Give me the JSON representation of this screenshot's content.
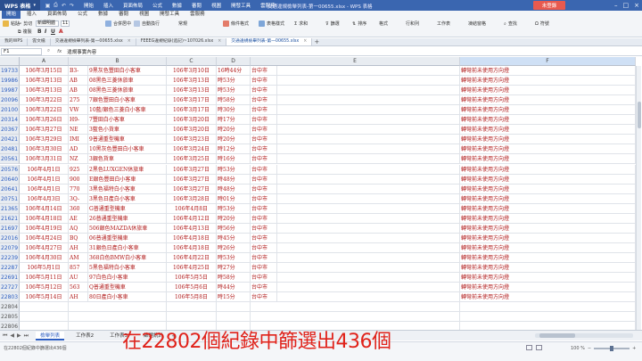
{
  "app": {
    "badge": "WPS 表格",
    "menus": [
      "開始",
      "插入",
      "頁面佈局",
      "公式",
      "數據",
      "審閱",
      "視圖",
      "開發工具",
      "雲服務"
    ],
    "doc_title": "交通違規檢舉列表-第一00655.xlsx - WPS 表格",
    "login_label": "未登錄",
    "accent": "#3a66b0"
  },
  "ribbon": {
    "active_tab": "開始",
    "font_name": "新細明體",
    "font_size": "11",
    "tools": [
      "剪切",
      "複製",
      "格式刷",
      "粘貼",
      "合併居中",
      "自動換行",
      "常規",
      "條件格式",
      "表格樣式",
      "求和",
      "篩選",
      "排序",
      "格式",
      "行和列",
      "工作表",
      "凍結窗格",
      "查找",
      "符號"
    ]
  },
  "doc_tabs": [
    {
      "label": "我的WPS",
      "active": false
    },
    {
      "label": "雲文檔",
      "active": false
    },
    {
      "label": "交通違規檢舉列表-第一00655.xlsx",
      "active": false
    },
    {
      "label": "FEEEG違規紀錄(追記)~107026.xlsx",
      "active": false
    },
    {
      "label": "交通違規檢舉列表-第一00655.xlsx",
      "active": true
    }
  ],
  "formula_bar": {
    "name_box": "F1",
    "content": "違規事實內容"
  },
  "columns": [
    "A",
    "B",
    "C",
    "D",
    "E",
    "F"
  ],
  "rows": [
    {
      "num": "19733",
      "a": "106年3月15日",
      "b": "B3-",
      "b2": "9黑灰色豐田白小客車",
      "c": "106年3月10日",
      "d": "16時44分",
      "d2": "台中市",
      "f": "轉彎前未使用方向燈"
    },
    {
      "num": "19986",
      "a": "106年3月13日",
      "b": "AB",
      "b2": "08黑色三菱休旅車",
      "c": "106年3月13日",
      "d": "時53分",
      "d2": "台中市",
      "f": "轉彎前未使用方向燈"
    },
    {
      "num": "19987",
      "a": "106年3月13日",
      "b": "AB",
      "b2": "08黑色三菱休旅車",
      "c": "106年3月13日",
      "d": "時53分",
      "d2": "台中市",
      "f": "轉彎前未使用方向燈"
    },
    {
      "num": "20096",
      "a": "106年3月22日",
      "b": "275",
      "b2": "7銀色豐田白小客車",
      "c": "106年3月17日",
      "d": "時58分",
      "d2": "台中市",
      "f": "轉彎前未使用方向燈"
    },
    {
      "num": "20100",
      "a": "106年3月22日",
      "b": "VW",
      "b2": "10藍/銀色三菱白小客車",
      "c": "106年3月17日",
      "d": "時30分",
      "d2": "台中市",
      "f": "轉彎前未使用方向燈"
    },
    {
      "num": "20314",
      "a": "106年3月26日",
      "b": "H9-",
      "b2": "7豐田白小客車",
      "c": "106年3月20日",
      "d": "時17分",
      "d2": "台中市",
      "f": "轉彎前未使用方向燈"
    },
    {
      "num": "20367",
      "a": "106年3月27日",
      "b": "NE",
      "b2": "3藍色小貨車",
      "c": "106年3月20日",
      "d": "時20分",
      "d2": "台中市",
      "f": "轉彎前未使用方向燈"
    },
    {
      "num": "20421",
      "a": "106年3月29日",
      "b": "IMI",
      "b2": "9普通重型機車",
      "c": "106年3月23日",
      "d": "時20分",
      "d2": "台中市",
      "f": "轉彎前未使用方向燈"
    },
    {
      "num": "20481",
      "a": "106年3月30日",
      "b": "AD",
      "b2": "10黑灰色豐田白小客車",
      "c": "106年3月24日",
      "d": "時12分",
      "d2": "台中市",
      "f": "轉彎前未使用方向燈"
    },
    {
      "num": "20561",
      "a": "106年3月31日",
      "b": "NZ",
      "b2": "3銀色貨車",
      "c": "106年3月25日",
      "d": "時16分",
      "d2": "台中市",
      "f": "轉彎前未使用方向燈"
    },
    {
      "num": "20576",
      "a": "106年4月1日",
      "b": "925",
      "b2": "2黑色LUXGEN休旅車",
      "c": "106年3月27日",
      "d": "時53分",
      "d2": "台中市",
      "f": "轉彎前未使用方向燈"
    },
    {
      "num": "20640",
      "a": "106年4月1日",
      "b": "900",
      "b2": "E銀色豐田白小客車",
      "c": "106年3月27日",
      "d": "時48分",
      "d2": "台中市",
      "f": "轉彎前未使用方向燈"
    },
    {
      "num": "20641",
      "a": "106年4月1日",
      "b": "770",
      "b2": "3黑色福特白小客車",
      "c": "106年3月27日",
      "d": "時48分",
      "d2": "台中市",
      "f": "轉彎前未使用方向燈"
    },
    {
      "num": "20751",
      "a": "106年4月3日",
      "b": "3Q-",
      "b2": "3黑色日產白小客車",
      "c": "106年3月28日",
      "d": "時01分",
      "d2": "台中市",
      "f": "轉彎前未使用方向燈"
    },
    {
      "num": "21365",
      "a": "106年4月14日",
      "b": "360",
      "b2": "G普通重型機車",
      "c": "106年4月8日",
      "d": "時53分",
      "d2": "台中市",
      "f": "轉彎前未使用方向燈"
    },
    {
      "num": "21621",
      "a": "106年4月18日",
      "b": "AE",
      "b2": "26普通重型機車",
      "c": "106年4月12日",
      "d": "時20分",
      "d2": "台中市",
      "f": "轉彎前未使用方向燈"
    },
    {
      "num": "21697",
      "a": "106年4月19日",
      "b": "AQ",
      "b2": "506銀色MAZDA休旅車",
      "c": "106年4月13日",
      "d": "時56分",
      "d2": "台中市",
      "f": "轉彎前未使用方向燈"
    },
    {
      "num": "22016",
      "a": "106年4月24日",
      "b": "BQ",
      "b2": "06普通重型機車",
      "c": "106年4月18日",
      "d": "時45分",
      "d2": "台中市",
      "f": "轉彎前未使用方向燈"
    },
    {
      "num": "22079",
      "a": "106年4月27日",
      "b": "AH",
      "b2": "31銀色日產白小客車",
      "c": "106年4月18日",
      "d": "時26分",
      "d2": "台中市",
      "f": "轉彎前未使用方向燈"
    },
    {
      "num": "22239",
      "a": "106年4月30日",
      "b": "AM",
      "b2": "368白色BMW白小客車",
      "c": "106年4月22日",
      "d": "時53分",
      "d2": "台中市",
      "f": "轉彎前未使用方向燈"
    },
    {
      "num": "22287",
      "a": "106年5月1日",
      "b": "857",
      "b2": "5黑色福特白小客車",
      "c": "106年4月25日",
      "d": "時27分",
      "d2": "台中市",
      "f": "轉彎前未使用方向燈"
    },
    {
      "num": "22691",
      "a": "106年5月11日",
      "b": "AU",
      "b2": "97白色白小客車",
      "c": "106年5月5日",
      "d": "時58分",
      "d2": "台中市",
      "f": "轉彎前未使用方向燈"
    },
    {
      "num": "22727",
      "a": "106年5月12日",
      "b": "563",
      "b2": "Q普通重型機車",
      "c": "106年5月6日",
      "d": "時44分",
      "d2": "台中市",
      "f": "轉彎前未使用方向燈"
    },
    {
      "num": "22803",
      "a": "106年5月14日",
      "b": "AH",
      "b2": "80日產白小客車",
      "c": "106年5月8日",
      "d": "時15分",
      "d2": "台中市",
      "f": "轉彎前未使用方向燈"
    }
  ],
  "empty_rows": [
    "22804",
    "22805",
    "22806"
  ],
  "sheets": {
    "tabs": [
      "檢舉列表",
      "工作表2",
      "工作表3",
      "篩選統計"
    ],
    "active": "檢舉列表"
  },
  "status": {
    "text": "在22802個紀錄中篩選出436個",
    "zoom": "100 %"
  },
  "caption": "在22802個紀錄中篩選出436個"
}
